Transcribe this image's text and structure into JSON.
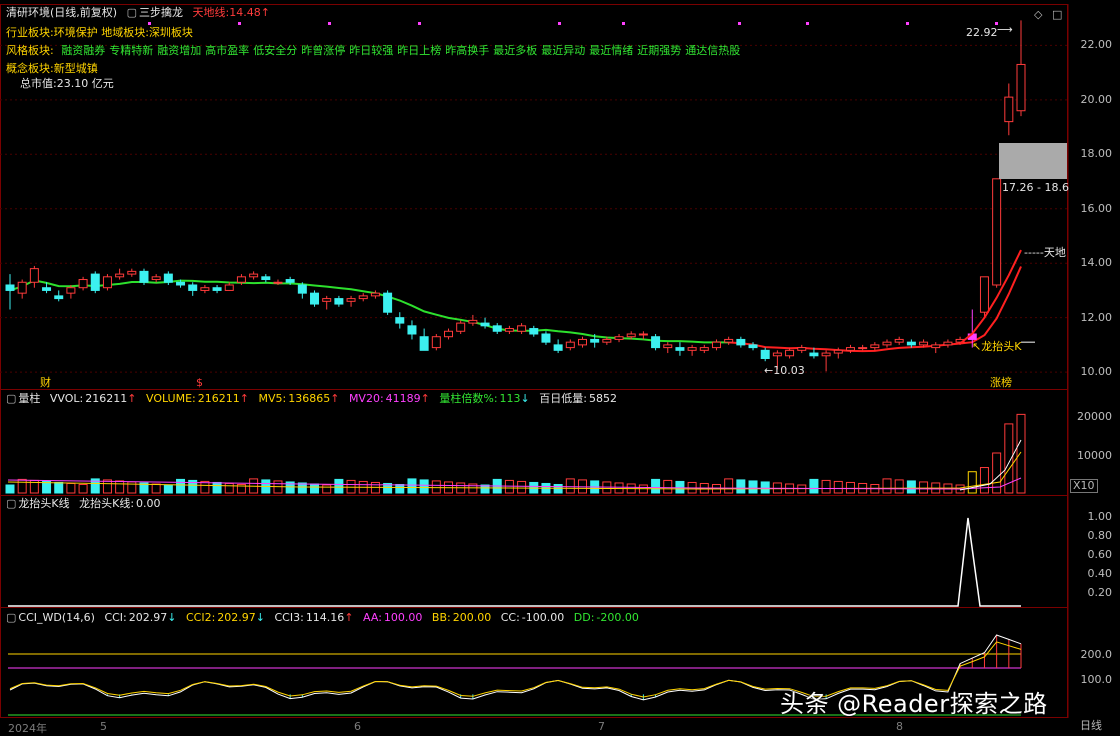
{
  "header": {
    "stock_name": "清研环境",
    "period_mode": "(日线,前复权)",
    "indicator_name": "三步擒龙",
    "tiandi_label": "天地线:",
    "tiandi_value": "14.48",
    "tiandi_arrow": "↑"
  },
  "sectors": {
    "industry_label": "行业板块:",
    "industry_value": "环境保护",
    "region_label": "地域板块:",
    "region_value": "深圳板块",
    "style_label": "风格板块:",
    "style_items": [
      "融资融券",
      "专精特新",
      "融资增加",
      "高市盈率",
      "低安全分",
      "昨曾涨停",
      "昨日较强",
      "昨日上榜",
      "昨高换手",
      "最近多板",
      "最近异动",
      "最近情绪",
      "近期强势",
      "通达信热股"
    ],
    "concept_label": "概念板块:",
    "concept_value": "新型城镇",
    "mcap_label": "总市值:",
    "mcap_value": "23.10 亿元"
  },
  "main_panel": {
    "price_axis": [
      "22.00",
      "20.00",
      "18.00",
      "16.00",
      "14.00",
      "12.00",
      "10.00"
    ],
    "high_label": "22.92",
    "low_label": "10.03",
    "range_label": "17.26 - 18.6",
    "tiandi_tag": "天地",
    "dragon_tag": "龙抬头K",
    "zhangbang_tag": "涨榜",
    "finance_tag": "财",
    "dollar_tag": "$"
  },
  "volume_panel": {
    "name": "量柱",
    "vvol_label": "VVOL:",
    "vvol_value": "216211",
    "volume_label": "VOLUME:",
    "volume_value": "216211",
    "mv5_label": "MV5:",
    "mv5_value": "136865",
    "mv20_label": "MV20:",
    "mv20_value": "41189",
    "ratio_label": "量柱倍数%:",
    "ratio_value": "113",
    "low100_label": "百日低量:",
    "low100_value": "5852",
    "axis": [
      "20000",
      "10000"
    ],
    "unit_badge": "X10"
  },
  "dragon_panel": {
    "name": "龙抬头K线",
    "line_label": "龙抬头K线:",
    "line_value": "0.00",
    "axis": [
      "1.00",
      "0.80",
      "0.60",
      "0.40",
      "0.20"
    ]
  },
  "cci_panel": {
    "name": "CCI_WD(14,6)",
    "cci_label": "CCI:",
    "cci_value": "202.97",
    "cci2_label": "CCI2:",
    "cci2_value": "202.97",
    "cci3_label": "CCI3:",
    "cci3_value": "114.16",
    "aa_label": "AA:",
    "aa_value": "100.00",
    "bb_label": "BB:",
    "bb_value": "200.00",
    "cc_label": "CC:",
    "cc_value": "-100.00",
    "dd_label": "DD:",
    "dd_value": "-200.00",
    "axis": [
      "200.0",
      "100.0"
    ]
  },
  "date_axis": {
    "labels": [
      "2024年",
      "5",
      "6",
      "7",
      "8"
    ],
    "period_button": "日线"
  },
  "watermark": "头条 @Reader探索之路",
  "colors": {
    "up": "#ff3b3b",
    "down": "#3cf0f0",
    "ma": "#2de02d",
    "tiandi_line": "#ff2020",
    "grid": "#5a0000"
  },
  "chart_data": {
    "type": "candlestick",
    "ylim": [
      9.6,
      23.3
    ],
    "candles": [
      [
        13.2,
        13.6,
        12.3,
        13.0
      ],
      [
        12.9,
        13.4,
        12.7,
        13.3
      ],
      [
        13.3,
        13.9,
        13.1,
        13.8
      ],
      [
        13.1,
        13.3,
        12.9,
        13.0
      ],
      [
        12.8,
        13.0,
        12.6,
        12.7
      ],
      [
        12.9,
        13.2,
        12.7,
        13.1
      ],
      [
        13.1,
        13.5,
        13.0,
        13.4
      ],
      [
        13.6,
        13.7,
        12.9,
        13.0
      ],
      [
        13.1,
        13.6,
        13.0,
        13.5
      ],
      [
        13.5,
        13.8,
        13.4,
        13.6
      ],
      [
        13.6,
        13.8,
        13.5,
        13.7
      ],
      [
        13.7,
        13.8,
        13.2,
        13.3
      ],
      [
        13.4,
        13.6,
        13.3,
        13.5
      ],
      [
        13.6,
        13.7,
        13.2,
        13.3
      ],
      [
        13.3,
        13.4,
        13.1,
        13.2
      ],
      [
        13.2,
        13.3,
        12.8,
        13.0
      ],
      [
        13.0,
        13.2,
        12.9,
        13.1
      ],
      [
        13.1,
        13.2,
        12.9,
        13.0
      ],
      [
        13.0,
        13.3,
        13.0,
        13.2
      ],
      [
        13.3,
        13.6,
        13.2,
        13.5
      ],
      [
        13.5,
        13.7,
        13.4,
        13.6
      ],
      [
        13.5,
        13.6,
        13.3,
        13.4
      ],
      [
        13.3,
        13.4,
        13.2,
        13.3
      ],
      [
        13.4,
        13.5,
        13.2,
        13.3
      ],
      [
        13.2,
        13.3,
        12.7,
        12.9
      ],
      [
        12.9,
        13.0,
        12.4,
        12.5
      ],
      [
        12.6,
        12.8,
        12.3,
        12.7
      ],
      [
        12.7,
        12.8,
        12.4,
        12.5
      ],
      [
        12.6,
        12.8,
        12.4,
        12.7
      ],
      [
        12.7,
        12.9,
        12.6,
        12.8
      ],
      [
        12.8,
        13.0,
        12.7,
        12.9
      ],
      [
        12.9,
        13.0,
        12.1,
        12.2
      ],
      [
        12.0,
        12.2,
        11.6,
        11.8
      ],
      [
        11.7,
        11.9,
        11.2,
        11.4
      ],
      [
        11.3,
        11.6,
        10.8,
        10.8
      ],
      [
        10.9,
        11.4,
        10.8,
        11.3
      ],
      [
        11.3,
        11.6,
        11.2,
        11.5
      ],
      [
        11.5,
        11.9,
        11.4,
        11.8
      ],
      [
        11.8,
        12.1,
        11.7,
        11.9
      ],
      [
        11.8,
        12.0,
        11.6,
        11.7
      ],
      [
        11.7,
        11.8,
        11.4,
        11.5
      ],
      [
        11.5,
        11.7,
        11.4,
        11.6
      ],
      [
        11.5,
        11.8,
        11.4,
        11.7
      ],
      [
        11.6,
        11.7,
        11.3,
        11.4
      ],
      [
        11.4,
        11.5,
        11.0,
        11.1
      ],
      [
        11.0,
        11.2,
        10.7,
        10.8
      ],
      [
        10.9,
        11.2,
        10.8,
        11.1
      ],
      [
        11.0,
        11.3,
        10.9,
        11.2
      ],
      [
        11.2,
        11.4,
        10.9,
        11.1
      ],
      [
        11.1,
        11.3,
        11.0,
        11.2
      ],
      [
        11.2,
        11.4,
        11.1,
        11.3
      ],
      [
        11.3,
        11.5,
        11.2,
        11.4
      ],
      [
        11.4,
        11.5,
        11.2,
        11.4
      ],
      [
        11.3,
        11.4,
        10.8,
        10.9
      ],
      [
        10.9,
        11.1,
        10.7,
        11.0
      ],
      [
        10.9,
        11.1,
        10.6,
        10.8
      ],
      [
        10.8,
        11.0,
        10.6,
        10.9
      ],
      [
        10.8,
        11.0,
        10.7,
        10.9
      ],
      [
        10.9,
        11.2,
        10.8,
        11.1
      ],
      [
        11.1,
        11.3,
        11.0,
        11.2
      ],
      [
        11.2,
        11.3,
        10.9,
        11.0
      ],
      [
        11.0,
        11.1,
        10.8,
        10.9
      ],
      [
        10.8,
        10.9,
        10.4,
        10.5
      ],
      [
        10.6,
        10.8,
        10.1,
        10.7
      ],
      [
        10.6,
        10.9,
        10.5,
        10.8
      ],
      [
        10.8,
        11.0,
        10.7,
        10.9
      ],
      [
        10.7,
        10.9,
        10.5,
        10.6
      ],
      [
        10.6,
        10.8,
        10.03,
        10.7
      ],
      [
        10.7,
        10.9,
        10.5,
        10.8
      ],
      [
        10.8,
        11.0,
        10.7,
        10.9
      ],
      [
        10.9,
        11.0,
        10.8,
        10.9
      ],
      [
        10.9,
        11.1,
        10.8,
        11.0
      ],
      [
        11.0,
        11.2,
        10.9,
        11.1
      ],
      [
        11.1,
        11.3,
        11.0,
        11.2
      ],
      [
        11.1,
        11.2,
        10.9,
        11.0
      ],
      [
        11.0,
        11.2,
        10.9,
        11.1
      ],
      [
        10.9,
        11.1,
        10.7,
        11.0
      ],
      [
        11.0,
        11.2,
        10.9,
        11.1
      ],
      [
        11.1,
        11.3,
        11.0,
        11.2
      ],
      [
        11.2,
        12.3,
        10.9,
        11.4
      ],
      [
        12.2,
        13.0,
        12.0,
        13.5
      ],
      [
        13.2,
        16.9,
        13.1,
        17.1
      ],
      [
        19.2,
        20.6,
        18.7,
        20.1
      ],
      [
        19.6,
        22.92,
        19.4,
        21.3
      ]
    ],
    "ma_end": 11.0,
    "tiandi_end": 14.48
  }
}
